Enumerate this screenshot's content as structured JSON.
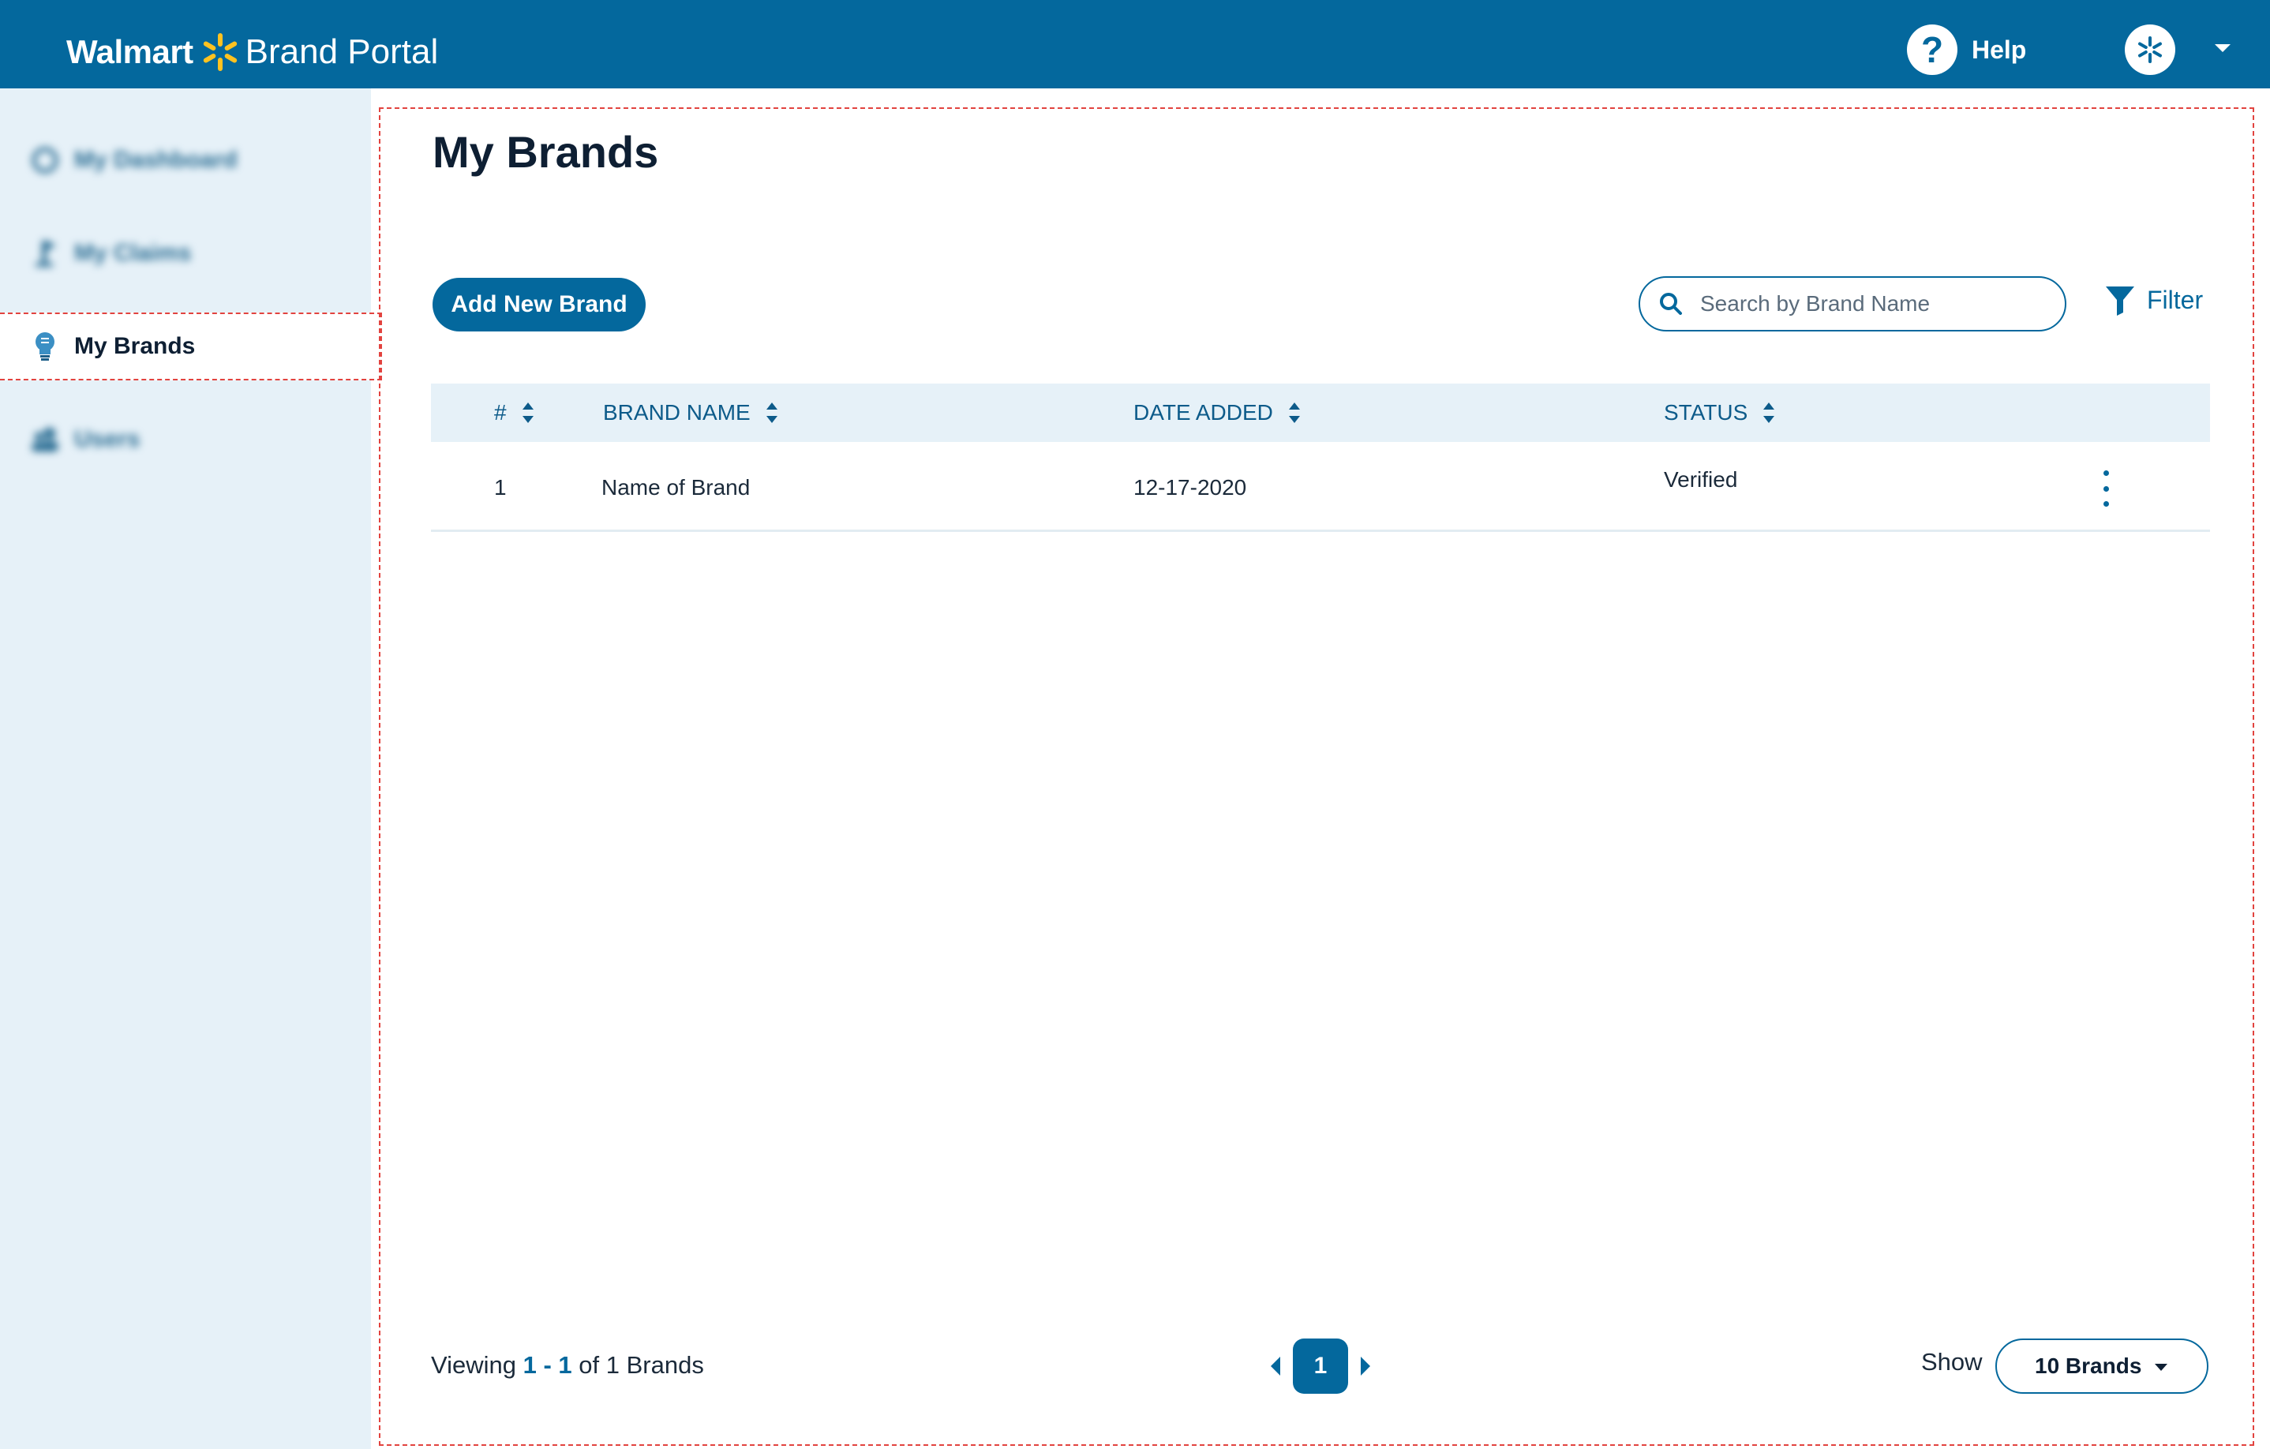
{
  "header": {
    "logo_walmart": "Walmart",
    "logo_portal": "Brand Portal",
    "help_glyph": "?",
    "help_label": "Help",
    "user_icon": "spark-avatar-icon",
    "menu_icon": "caret-down-icon"
  },
  "sidebar": {
    "items": [
      {
        "label": "My Dashboard",
        "icon": "dashboard-icon",
        "active": false
      },
      {
        "label": "My Claims",
        "icon": "claims-flag-icon",
        "active": false
      },
      {
        "label": "My Brands",
        "icon": "lightbulb-icon",
        "active": true
      },
      {
        "label": "Users",
        "icon": "users-icon",
        "active": false
      }
    ]
  },
  "main": {
    "title": "My Brands",
    "add_button": "Add New Brand",
    "search_placeholder": "Search by Brand Name",
    "search_value": "",
    "filter_label": "Filter"
  },
  "table": {
    "columns": [
      "#",
      "BRAND NAME",
      "DATE ADDED",
      "STATUS"
    ],
    "rows": [
      {
        "num": "1",
        "brand_name": "Name of Brand",
        "date_added": "12-17-2020",
        "status": "Verified"
      }
    ]
  },
  "footer": {
    "viewing_prefix": "Viewing",
    "viewing_range": "1 - 1",
    "viewing_suffix": "of 1 Brands",
    "current_page": "1",
    "show_label": "Show",
    "show_value": "10 Brands"
  },
  "colors": {
    "brand_blue": "#04689d",
    "spark_yellow": "#ffc220",
    "sidebar_bg": "#e6f1f8",
    "highlight_dash": "#e2433f"
  }
}
